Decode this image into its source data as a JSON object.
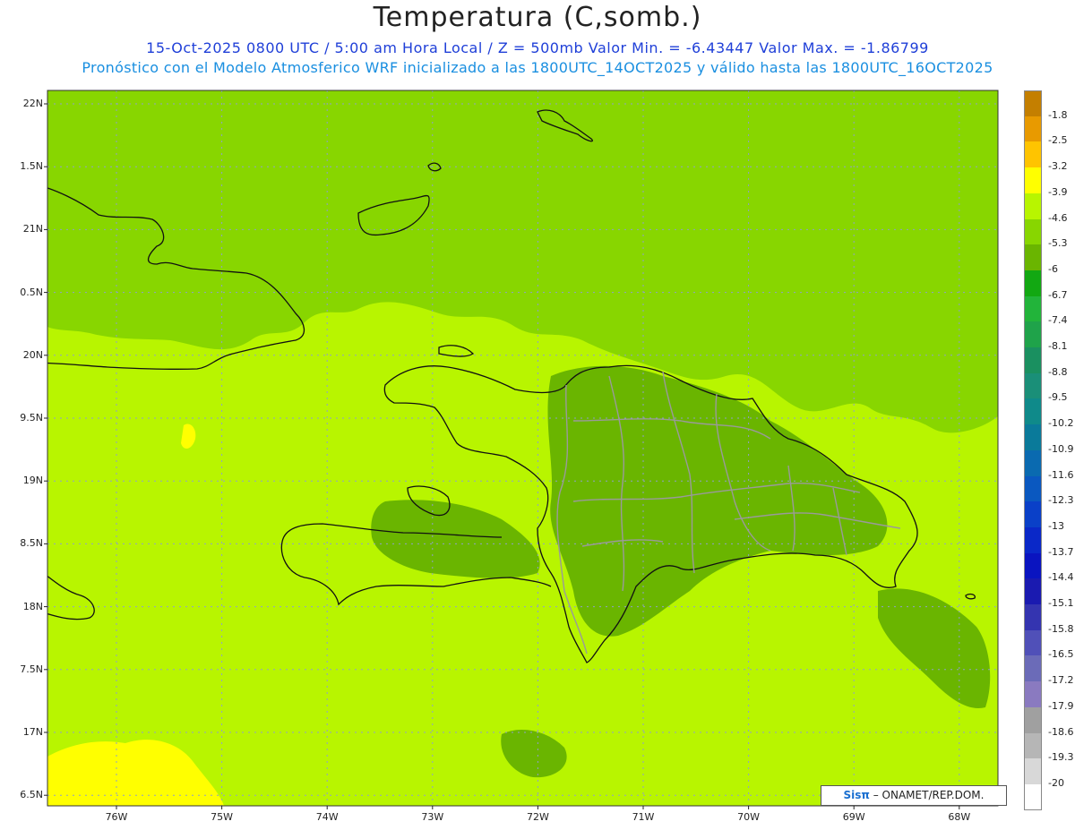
{
  "header": {
    "title": "Temperatura (C,somb.)",
    "subtitle1": "15-Oct-2025  0800 UTC / 5:00 am Hora Local / Z = 500mb  Valor Min. = -6.43447  Valor Max. = -1.86799",
    "subtitle2": "Pronóstico con el Modelo Atmosferico WRF inicializado a las 1800UTC_14OCT2025 y válido hasta las  1800UTC_16OCT2025"
  },
  "axes": {
    "lat_labels": [
      "22N",
      "1.5N",
      "21N",
      "0.5N",
      "20N",
      "9.5N",
      "19N",
      "8.5N",
      "18N",
      "7.5N",
      "17N",
      "6.5N"
    ],
    "lon_labels": [
      "76W",
      "75W",
      "74W",
      "73W",
      "72W",
      "71W",
      "70W",
      "69W",
      "68W"
    ]
  },
  "colorbar": {
    "labels": [
      "-1.8",
      "-2.5",
      "-3.2",
      "-3.9",
      "-4.6",
      "-5.3",
      "-6",
      "-6.7",
      "-7.4",
      "-8.1",
      "-8.8",
      "-9.5",
      "-10.2",
      "-10.9",
      "-11.6",
      "-12.3",
      "-13",
      "-13.7",
      "-14.4",
      "-15.1",
      "-15.8",
      "-16.5",
      "-17.2",
      "-17.9",
      "-18.6",
      "-19.3",
      "-20"
    ],
    "colors": [
      "#c47f00",
      "#e89a00",
      "#ffc400",
      "#ffff00",
      "#b8f500",
      "#88d600",
      "#6ab500",
      "#12a812",
      "#22b43a",
      "#1fa34a",
      "#1a9060",
      "#1a8f78",
      "#0f8a8a",
      "#0a7a9a",
      "#0a6ab0",
      "#0a58c0",
      "#0a40c8",
      "#0a28c8",
      "#0a14c0",
      "#1a1ab0",
      "#3434b0",
      "#5050b8",
      "#6b6bb8",
      "#8a7ac0",
      "#a0a0a0",
      "#b6b6b6",
      "#d8d8d8",
      "#ffffff"
    ]
  },
  "map": {
    "background_color": "#b8f500",
    "north_color": "#88d600",
    "darker_patch_color": "#6ab500",
    "warm_patch_color": "#ffff00"
  },
  "credit": {
    "logo": "Sisπ",
    "text": " – ONAMET/REP.DOM."
  }
}
